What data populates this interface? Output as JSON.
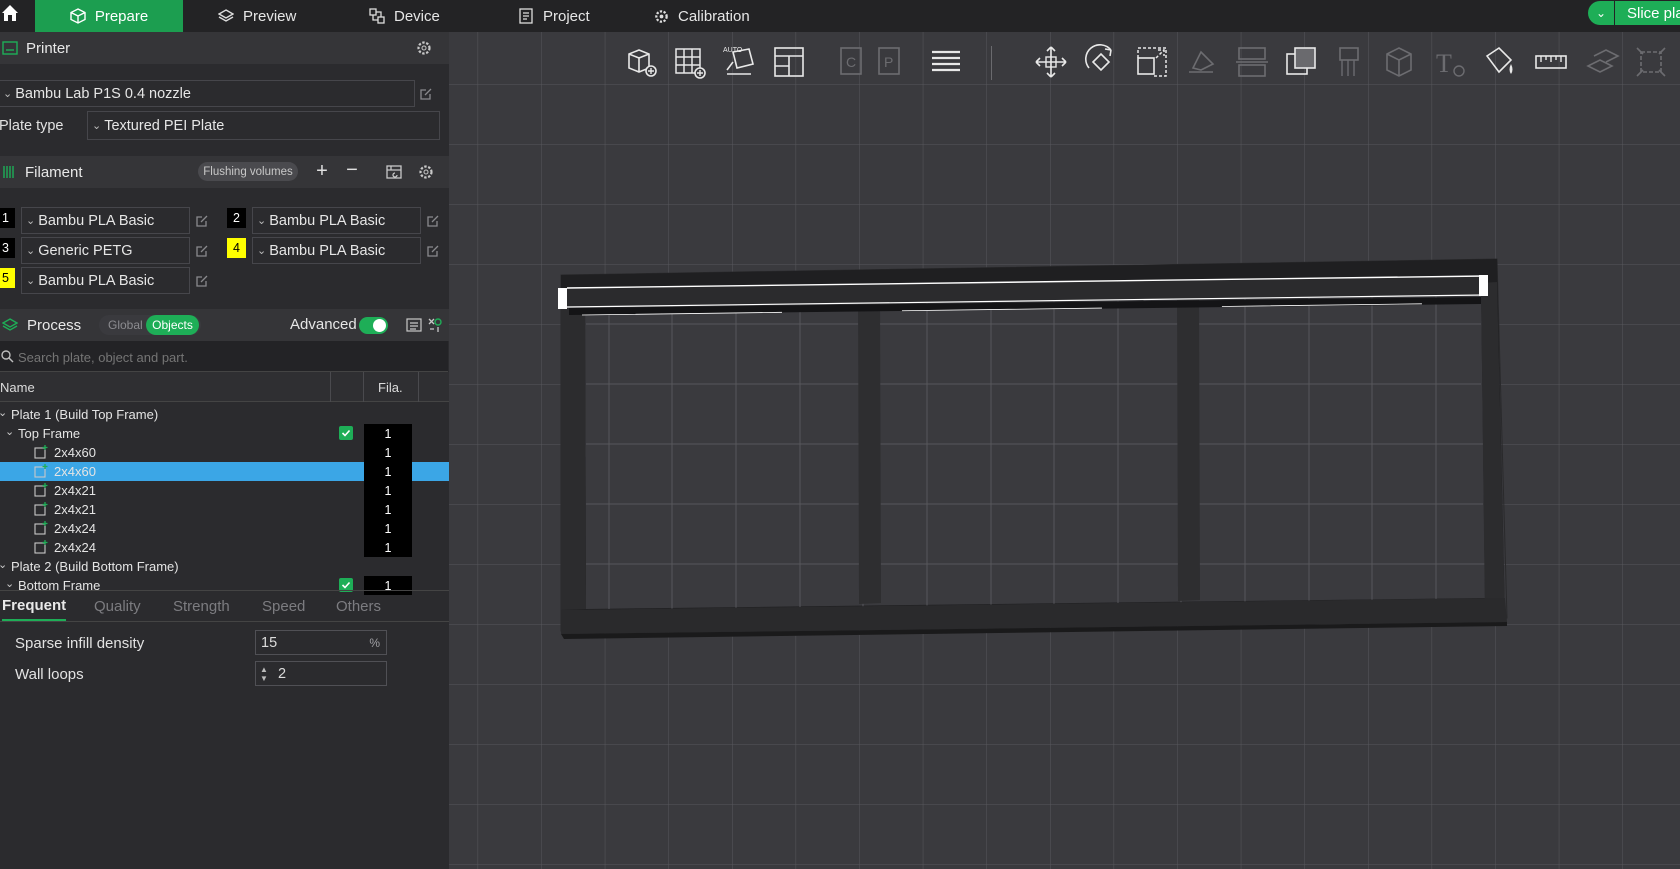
{
  "topbar": {
    "tabs": [
      {
        "label": "Prepare",
        "icon": "cube-icon"
      },
      {
        "label": "Preview",
        "icon": "layers-icon"
      },
      {
        "label": "Device",
        "icon": "device-icon"
      },
      {
        "label": "Project",
        "icon": "project-icon"
      },
      {
        "label": "Calibration",
        "icon": "gear-icon"
      }
    ],
    "active_tab": "Prepare",
    "slice_label": "Slice pla"
  },
  "printer": {
    "section_title": "Printer",
    "selected_printer": "Bambu Lab P1S 0.4 nozzle",
    "plate_type_label": "Plate type",
    "plate_type_value": "Textured PEI Plate"
  },
  "filament": {
    "section_title": "Filament",
    "flushing_label": "Flushing volumes",
    "slots": [
      {
        "num": "1",
        "name": "Bambu PLA Basic",
        "color": "#000000"
      },
      {
        "num": "2",
        "name": "Bambu PLA Basic",
        "color": "#000000"
      },
      {
        "num": "3",
        "name": "Generic PETG",
        "color": "#000000"
      },
      {
        "num": "4",
        "name": "Bambu PLA Basic",
        "color": "#ffff00"
      },
      {
        "num": "5",
        "name": "Bambu PLA Basic",
        "color": "#ffff00"
      }
    ]
  },
  "process": {
    "section_title": "Process",
    "global_label": "Global",
    "objects_label": "Objects",
    "objects_selected": true,
    "advanced_label": "Advanced",
    "advanced_on": true
  },
  "search": {
    "placeholder": "Search plate, object and part."
  },
  "object_list": {
    "col_name": "Name",
    "col_fila": "Fila.",
    "rows": [
      {
        "text": "Plate 1 (Build Top Frame)",
        "level": 0,
        "kind": "plate",
        "fila": ""
      },
      {
        "text": "Top Frame",
        "level": 1,
        "kind": "object",
        "fila": "1",
        "checked": true
      },
      {
        "text": "2x4x60",
        "level": 2,
        "kind": "part",
        "fila": "1"
      },
      {
        "text": "2x4x60",
        "level": 2,
        "kind": "part",
        "fila": "1",
        "selected": true
      },
      {
        "text": "2x4x21",
        "level": 2,
        "kind": "part",
        "fila": "1"
      },
      {
        "text": "2x4x21",
        "level": 2,
        "kind": "part",
        "fila": "1"
      },
      {
        "text": "2x4x24",
        "level": 2,
        "kind": "part",
        "fila": "1"
      },
      {
        "text": "2x4x24",
        "level": 2,
        "kind": "part",
        "fila": "1"
      },
      {
        "text": "Plate 2 (Build Bottom Frame)",
        "level": 0,
        "kind": "plate",
        "fila": ""
      },
      {
        "text": "Bottom Frame",
        "level": 1,
        "kind": "object",
        "fila": "1",
        "checked": true
      }
    ]
  },
  "param_tabs": [
    "Frequent",
    "Quality",
    "Strength",
    "Speed",
    "Others"
  ],
  "active_param_tab": "Frequent",
  "settings": {
    "sparse_infill_label": "Sparse infill density",
    "sparse_infill_value": "15",
    "sparse_infill_unit": "%",
    "wall_loops_label": "Wall loops",
    "wall_loops_value": "2"
  },
  "toolbar": {
    "icons": [
      "add-object-icon",
      "arrange-grid-icon",
      "auto-orient-icon",
      "plate-layout-icon",
      "copy-icon",
      "paste-icon",
      "layers-list-icon",
      "move-icon",
      "rotate-icon",
      "scale-icon",
      "lay-on-face-icon",
      "cut-icon",
      "boolean-icon",
      "support-paint-icon",
      "seam-paint-icon",
      "text-icon",
      "color-paint-icon",
      "measure-icon",
      "assembly-icon",
      "assemble-view-icon"
    ],
    "disabled": [
      false,
      false,
      false,
      false,
      true,
      true,
      false,
      false,
      false,
      false,
      true,
      true,
      false,
      true,
      true,
      true,
      false,
      false,
      true,
      true
    ]
  },
  "colors": {
    "accent": "#1eae57",
    "selection": "#3ba6e6"
  }
}
